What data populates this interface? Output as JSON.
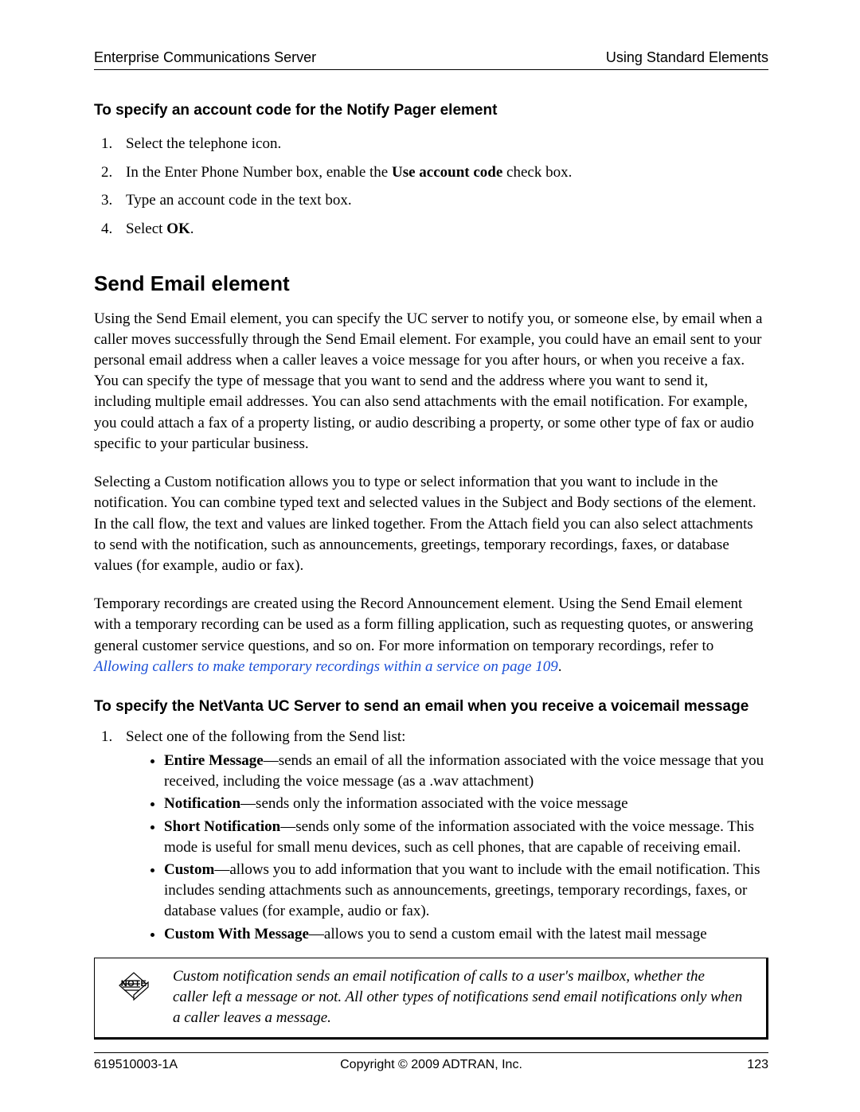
{
  "header": {
    "left": "Enterprise Communications Server",
    "right": "Using Standard Elements"
  },
  "section1": {
    "title": "To specify an account code for the Notify Pager element",
    "steps": {
      "s1": "Select the telephone icon.",
      "s2_pre": "In the Enter Phone Number box, enable the ",
      "s2_bold": "Use account code",
      "s2_post": " check box.",
      "s3": "Type an account code in the text box.",
      "s4_pre": "Select ",
      "s4_bold": "OK",
      "s4_post": "."
    }
  },
  "section2": {
    "title": "Send Email element",
    "p1": "Using the Send Email element, you can specify the UC server to notify you, or someone else, by email when a caller moves successfully through the Send Email element. For example, you could have an email sent to your personal email address when a caller leaves a voice message for you after hours, or when you receive a fax. You can specify the type of message that you want to send and the address where you want to send it, including multiple email addresses. You can also send attachments with the email notification. For example, you could attach a fax of a property listing, or audio describing a property, or some other type of fax or audio specific to your particular business.",
    "p2": "Selecting a Custom notification allows you to type or select information that you want to include in the notification. You can combine typed text and selected values in the Subject and Body sections of the element. In the call flow, the text and values are linked together. From the Attach field you can also select attachments to send with the notification, such as announcements, greetings, temporary recordings, faxes, or database values (for example, audio or fax).",
    "p3_pre": "Temporary recordings are created using the Record Announcement element. Using the Send Email element with a temporary recording can be used as a form filling application, such as requesting quotes, or answering general customer service questions, and so on. For more information on temporary recordings, refer to ",
    "p3_link": "Allowing callers to make temporary recordings within a service on page 109",
    "p3_post": "."
  },
  "section3": {
    "title": "To specify the NetVanta UC Server to send an email when you receive a voicemail message",
    "lead": "Select one of the following from the Send list:",
    "items": {
      "i1_bold": "Entire Message",
      "i1_text": "—sends an email of all the information associated with the voice message that you received, including the voice message (as a .wav attachment)",
      "i2_bold": "Notification",
      "i2_text": "—sends only the information associated with the voice message",
      "i3_bold": "Short Notification",
      "i3_text": "—sends only some of the information associated with the voice message. This mode is useful for small menu devices, such as cell phones, that are capable of receiving email.",
      "i4_bold": "Custom",
      "i4_text": "—allows you to add information that you want to include with the email notification. This includes sending attachments such as announcements, greetings, temporary recordings, faxes, or database values (for example, audio or fax).",
      "i5_bold": "Custom With Message",
      "i5_text": "—allows you to send a custom email with the latest mail message"
    }
  },
  "note": {
    "label": "NOTE",
    "text": "Custom notification sends an email notification of calls to a user's mailbox, whether the caller left a message or not. All other types of notifications send email notifications only when a caller leaves a message."
  },
  "footer": {
    "left": "619510003-1A",
    "center": "Copyright © 2009 ADTRAN, Inc.",
    "right": "123"
  }
}
